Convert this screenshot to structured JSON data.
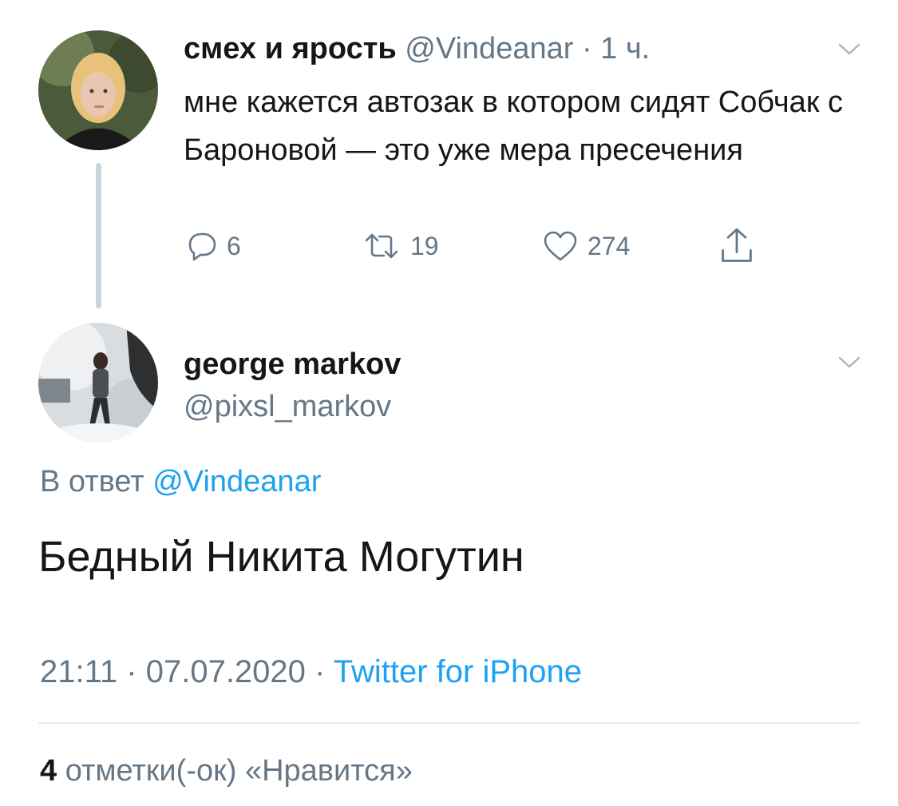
{
  "parent_tweet": {
    "display_name": "смех и ярость",
    "handle": "@Vindeanar",
    "separator": "·",
    "time": "1 ч.",
    "text": "мне кажется автозак в котором сидят Собчак с Бароновой — это уже мера пресечения",
    "actions": {
      "replies": "6",
      "retweets": "19",
      "likes": "274"
    },
    "icons": {
      "reply": "reply-bubble-icon",
      "retweet": "retweet-icon",
      "like": "heart-icon",
      "share": "share-icon",
      "menu": "chevron-down-icon"
    }
  },
  "reply_tweet": {
    "display_name": "george markov",
    "handle": "@pixsl_markov",
    "in_reply_prefix": "В ответ",
    "in_reply_handle": "@Vindeanar",
    "text": "Бедный Никита Могутин",
    "time": "21:11",
    "date": "07.07.2020",
    "separator": "·",
    "source": "Twitter for iPhone",
    "likes_count": "4",
    "likes_label": "отметки(-ок) «Нравится»"
  },
  "colors": {
    "text": "#14171a",
    "muted": "#657786",
    "link": "#1da1f2",
    "thread_line": "#cdd5dc",
    "divider": "#e6ecf0"
  }
}
